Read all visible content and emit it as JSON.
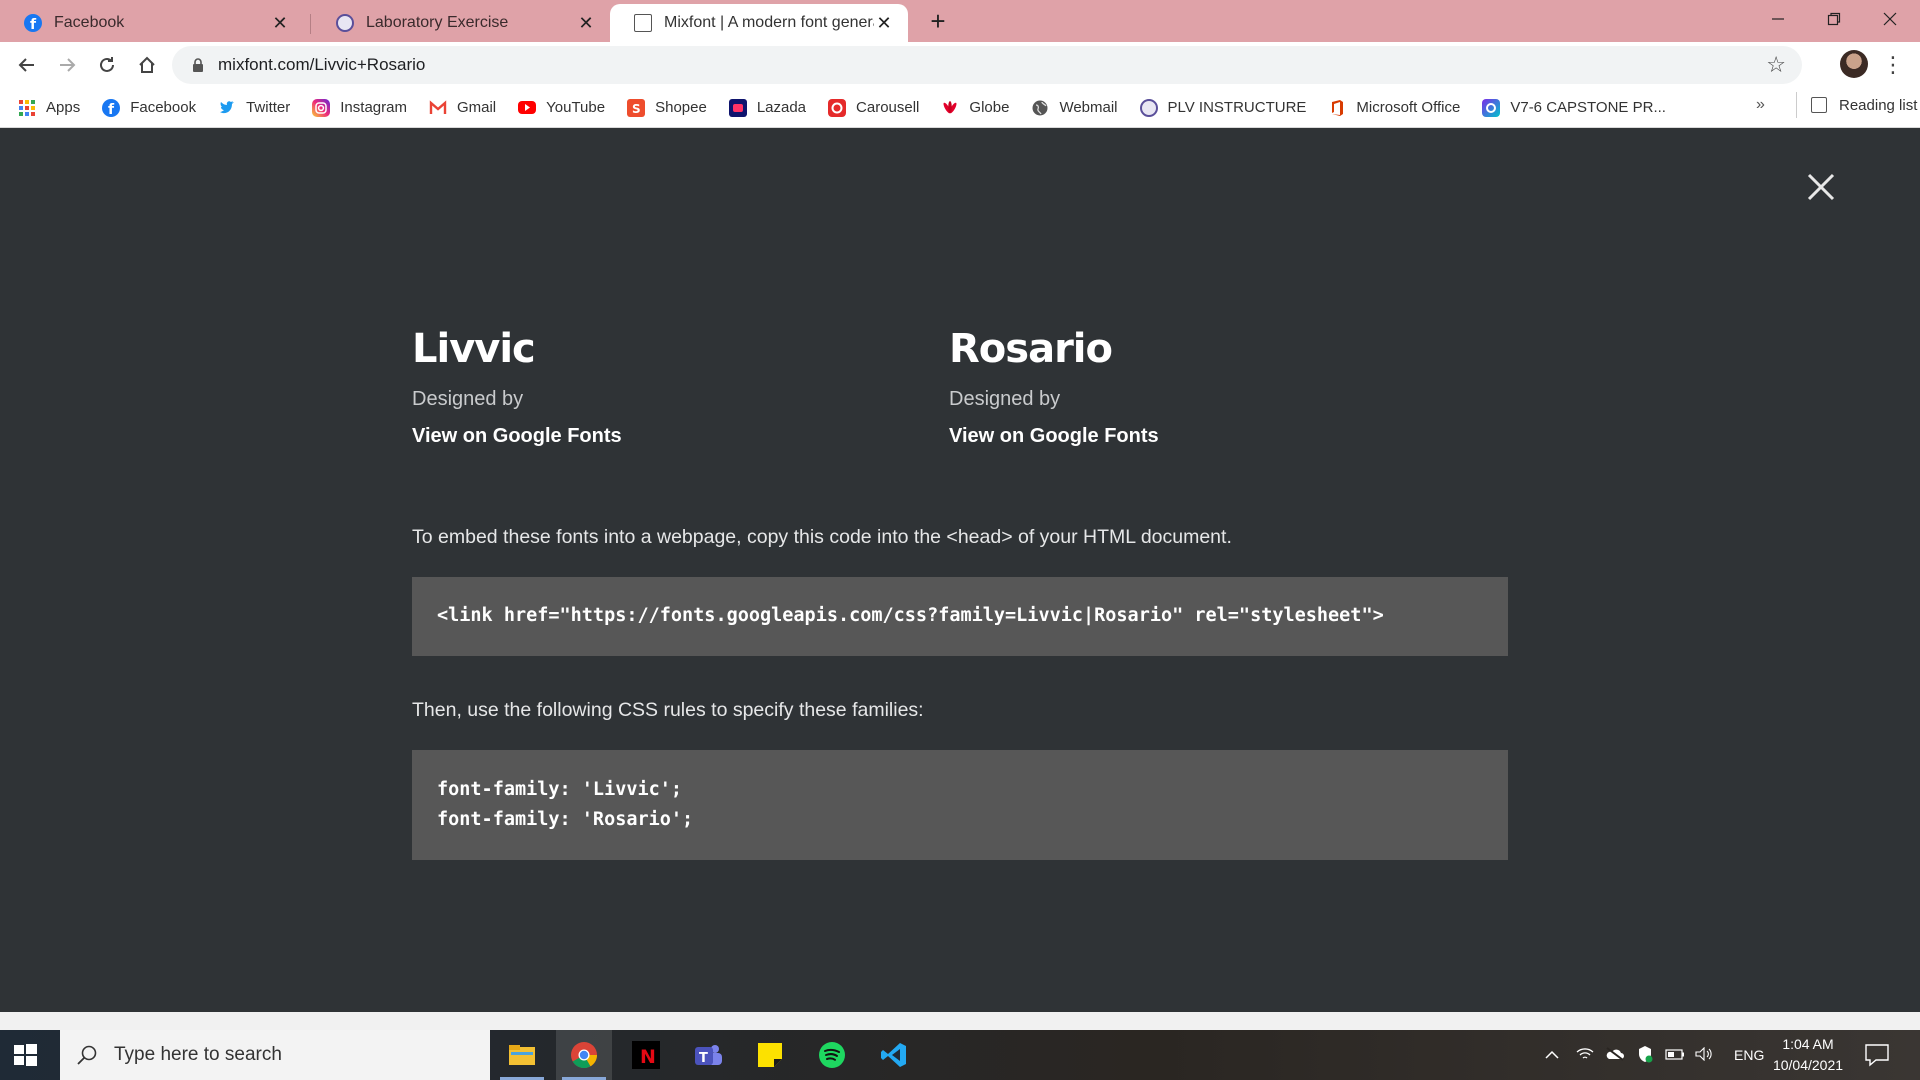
{
  "browser": {
    "tabs": [
      {
        "title": "Facebook",
        "icon": "facebook-icon",
        "active": false
      },
      {
        "title": "Laboratory Exercise",
        "icon": "plv-seal-icon",
        "active": false
      },
      {
        "title": "Mixfont | A modern font generat",
        "icon": "mixfont-icon",
        "active": true
      }
    ],
    "url": "mixfont.com/Livvic+Rosario",
    "bookmarks": [
      {
        "label": "Apps",
        "icon": "apps-grid-icon"
      },
      {
        "label": "Facebook",
        "icon": "facebook-icon"
      },
      {
        "label": "Twitter",
        "icon": "twitter-icon"
      },
      {
        "label": "Instagram",
        "icon": "instagram-icon"
      },
      {
        "label": "Gmail",
        "icon": "gmail-icon"
      },
      {
        "label": "YouTube",
        "icon": "youtube-icon"
      },
      {
        "label": "Shopee",
        "icon": "shopee-icon"
      },
      {
        "label": "Lazada",
        "icon": "lazada-icon"
      },
      {
        "label": "Carousell",
        "icon": "carousell-icon"
      },
      {
        "label": "Globe",
        "icon": "huawei-icon"
      },
      {
        "label": "Webmail",
        "icon": "globe-icon"
      },
      {
        "label": "PLV INSTRUCTURE",
        "icon": "plv-seal-icon"
      },
      {
        "label": "Microsoft Office",
        "icon": "office-icon"
      },
      {
        "label": "V7-6 CAPSTONE PR...",
        "icon": "canva-icon"
      }
    ],
    "more_bookmarks": "»",
    "reading_list": "Reading list"
  },
  "page": {
    "fonts": [
      {
        "name": "Livvic",
        "designed_by": "Designed by",
        "link": "View on Google Fonts"
      },
      {
        "name": "Rosario",
        "designed_by": "Designed by",
        "link": "View on Google Fonts"
      }
    ],
    "embed_text": "To embed these fonts into a webpage, copy this code into the <head> of your HTML document.",
    "embed_code": "<link href=\"https://fonts.googleapis.com/css?family=Livvic|Rosario\" rel=\"stylesheet\">",
    "css_text": "Then, use the following CSS rules to specify these families:",
    "css_lines": [
      "font-family: 'Livvic';",
      "font-family: 'Rosario';"
    ]
  },
  "taskbar": {
    "search_placeholder": "Type here to search",
    "apps": [
      "file-explorer-icon",
      "chrome-icon",
      "netflix-icon",
      "teams-icon",
      "sticky-notes-icon",
      "spotify-icon",
      "vscode-icon"
    ],
    "language": "ENG",
    "time": "1:04 AM",
    "date": "10/04/2021"
  },
  "colors": {
    "page_bg": "#2f3336",
    "code_bg": "#575757",
    "tab_strip": "#dfa2a8"
  }
}
